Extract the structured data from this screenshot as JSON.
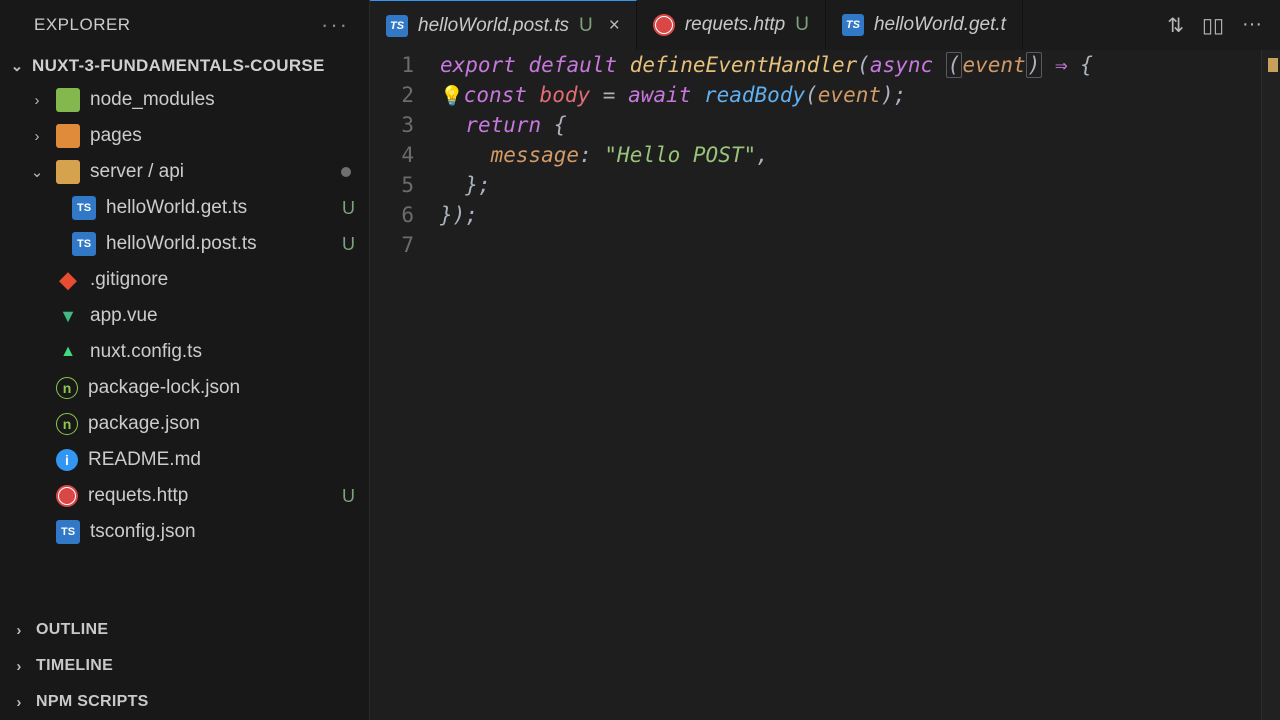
{
  "explorer": {
    "title": "EXPLORER",
    "project": "NUXT-3-FUNDAMENTALS-COURSE"
  },
  "tree": {
    "node_modules": "node_modules",
    "pages": "pages",
    "server_api": "server / api",
    "file_get": "helloWorld.get.ts",
    "file_post": "helloWorld.post.ts",
    "gitignore": ".gitignore",
    "app_vue": "app.vue",
    "nuxt_config": "nuxt.config.ts",
    "pkg_lock": "package-lock.json",
    "pkg": "package.json",
    "readme": "README.md",
    "requests": "requets.http",
    "tsconfig": "tsconfig.json",
    "status_U": "U"
  },
  "panels": {
    "outline": "OUTLINE",
    "timeline": "TIMELINE",
    "npm": "NPM SCRIPTS"
  },
  "tabs": {
    "t1": "helloWorld.post.ts",
    "t2": "requets.http",
    "t3": "helloWorld.get.t",
    "status_U": "U",
    "close": "×"
  },
  "code": {
    "l1": {
      "export": "export",
      "default": "default",
      "fn": "defineEventHandler",
      "async": "async",
      "event": "event",
      "arrow": "⇒"
    },
    "l2": {
      "const": "const",
      "body": "body",
      "await": "await",
      "readBody": "readBody",
      "event": "event"
    },
    "l3": {
      "return": "return"
    },
    "l4": {
      "message": "message",
      "str": "\"Hello POST\""
    },
    "l5": {},
    "l6": {},
    "lines": [
      "1",
      "2",
      "3",
      "4",
      "5",
      "6",
      "7"
    ]
  },
  "icons": {
    "ts": "TS",
    "info": "i"
  }
}
